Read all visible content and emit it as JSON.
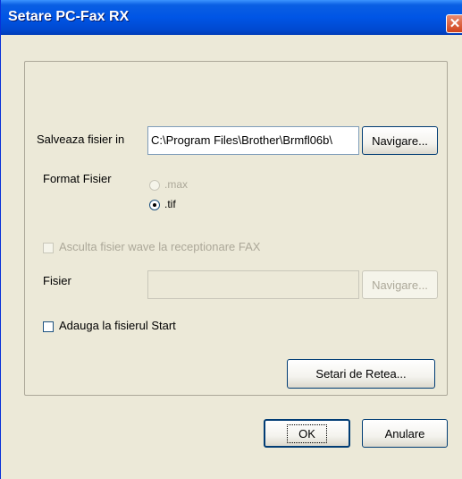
{
  "window": {
    "title": "Setare PC-Fax RX",
    "close_glyph": "✕"
  },
  "save_location": {
    "label": "Salveaza fisier in",
    "path": "C:\\Program Files\\Brother\\Brmfl06b\\",
    "browse_label": "Navigare..."
  },
  "file_format": {
    "label": "Format Fisier",
    "options": [
      {
        "label": ".max",
        "selected": false,
        "enabled": false
      },
      {
        "label": ".tif",
        "selected": true,
        "enabled": true
      }
    ]
  },
  "wave": {
    "label": "Asculta fisier wave la receptionare FAX",
    "checked": false,
    "enabled": false
  },
  "wave_file": {
    "label": "Fisier",
    "value": "",
    "browse_label": "Navigare..."
  },
  "startup": {
    "label": "Adauga la fisierul Start",
    "checked": false
  },
  "network_settings_label": "Setari de Retea...",
  "footer": {
    "ok_label": "OK",
    "cancel_label": "Anulare"
  }
}
